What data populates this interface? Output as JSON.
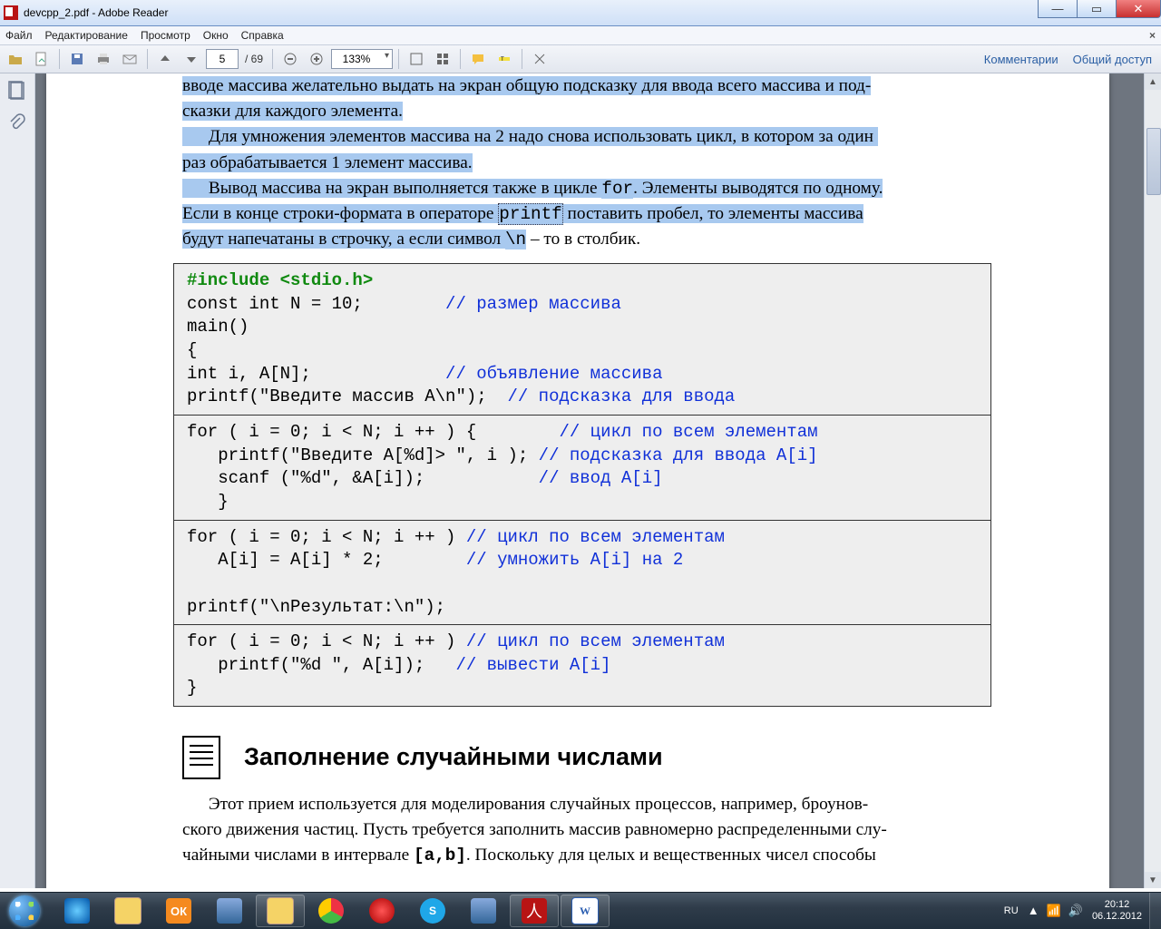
{
  "window": {
    "title": "devcpp_2.pdf - Adobe Reader"
  },
  "menu": {
    "file": "Файл",
    "edit": "Редактирование",
    "view": "Просмотр",
    "window": "Окно",
    "help": "Справка"
  },
  "toolbar": {
    "page_current": "5",
    "page_total": "/ 69",
    "zoom": "133%",
    "comments": "Комментарии",
    "share": "Общий доступ"
  },
  "doc": {
    "p1a": "вводе массива желательно выдать на экран общую подсказку для ввода всего массива и под-",
    "p1b": "сказки для каждого элемента.",
    "p2_indent": "      Для умножения элементов массива на 2 надо снова использовать цикл, в котором за один ",
    "p2b": "раз обрабатывается 1 элемент массива.",
    "p3_a": "      Вывод массива на экран выполняется также в цикле ",
    "p3_for": "for",
    "p3_b": ". Элементы выводятся по одному. ",
    "p3_c": "Если в конце строки-формата в операторе ",
    "p3_printf": "printf",
    "p3_d": " поставить пробел, то элементы массива ",
    "p3_e": "будут напечатаны в строчку, а если символ ",
    "p3_nl": "\\n",
    "p3_f": " – то в столбик.",
    "code": {
      "c1_l1_kw": "#include <stdio.h>",
      "c1_l2": "const int N = 10;        ",
      "c1_l2c": "// размер массива",
      "c1_l3": "main()",
      "c1_l4": "{",
      "c1_l5": "int i, A[N];             ",
      "c1_l5c": "// объявление массива",
      "c1_l6": "printf(\"Введите массив A\\n\");  ",
      "c1_l6c": "// подсказка для ввода",
      "c2_l1": "for ( i = 0; i < N; i ++ ) {        ",
      "c2_l1c": "// цикл по всем элементам",
      "c2_l2": "   printf(\"Введите A[%d]> \", i ); ",
      "c2_l2c": "// подсказка для ввода A[i]",
      "c2_l3": "   scanf (\"%d\", &A[i]);           ",
      "c2_l3c": "// ввод A[i]",
      "c2_l4": "   }",
      "c3_l1": "for ( i = 0; i < N; i ++ ) ",
      "c3_l1c": "// цикл по всем элементам",
      "c3_l2": "   A[i] = A[i] * 2;        ",
      "c3_l2c": "// умножить A[i] на 2",
      "c3_l3": "printf(\"\\nРезультат:\\n\");",
      "c4_l1": "for ( i = 0; i < N; i ++ ) ",
      "c4_l1c": "// цикл по всем элементам",
      "c4_l2": "   printf(\"%d \", A[i]);   ",
      "c4_l2c": "// вывести A[i]",
      "c4_l3": "}"
    },
    "section_title": "Заполнение случайными числами",
    "p4_a": "      Этот прием используется для моделирования случайных процессов, например, броунов-",
    "p4_b": "ского движения частиц. Пусть требуется заполнить массив равномерно распределенными слу-",
    "p4_c1": "чайными числами в интервале ",
    "p4_ab": "[a,b]",
    "p4_c2": ". Поскольку для целых и вещественных чисел способы"
  },
  "tray": {
    "lang": "RU",
    "time": "20:12",
    "date": "06.12.2012"
  }
}
